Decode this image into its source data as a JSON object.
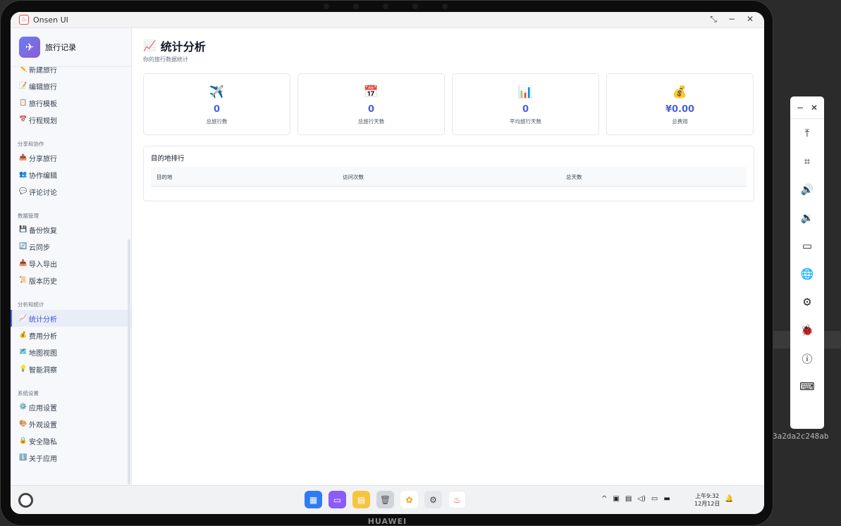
{
  "window": {
    "title": "Onsen UI"
  },
  "device": {
    "brand": "HUAWEI"
  },
  "sidebar": {
    "app_name": "旅行记录",
    "groups": [
      {
        "title": "",
        "items": [
          {
            "icon": "✏️",
            "label": "新建旅行",
            "partial": true
          },
          {
            "icon": "📝",
            "label": "编辑旅行"
          },
          {
            "icon": "📋",
            "label": "旅行模板"
          },
          {
            "icon": "📅",
            "label": "行程规划"
          }
        ]
      },
      {
        "title": "分享和协作",
        "items": [
          {
            "icon": "📤",
            "label": "分享旅行"
          },
          {
            "icon": "👥",
            "label": "协作编辑"
          },
          {
            "icon": "💬",
            "label": "评论讨论"
          }
        ]
      },
      {
        "title": "数据管理",
        "items": [
          {
            "icon": "💾",
            "label": "备份恢复"
          },
          {
            "icon": "🔄",
            "label": "云同步"
          },
          {
            "icon": "📥",
            "label": "导入导出"
          },
          {
            "icon": "📜",
            "label": "版本历史"
          }
        ]
      },
      {
        "title": "分析和统计",
        "items": [
          {
            "icon": "📈",
            "label": "统计分析",
            "active": true
          },
          {
            "icon": "💰",
            "label": "费用分析"
          },
          {
            "icon": "🗺️",
            "label": "地图视图"
          },
          {
            "icon": "💡",
            "label": "智能洞察"
          }
        ]
      },
      {
        "title": "系统设置",
        "items": [
          {
            "icon": "⚙️",
            "label": "应用设置"
          },
          {
            "icon": "🎨",
            "label": "外观设置"
          },
          {
            "icon": "🔒",
            "label": "安全隐私"
          },
          {
            "icon": "ℹ️",
            "label": "关于应用"
          }
        ]
      }
    ]
  },
  "main": {
    "title_icon": "📈",
    "title": "统计分析",
    "subtitle": "你的旅行数据统计",
    "stats": [
      {
        "icon": "✈️",
        "value": "0",
        "label": "总旅行数"
      },
      {
        "icon": "📅",
        "value": "0",
        "label": "总旅行天数"
      },
      {
        "icon": "📊",
        "value": "0",
        "label": "平均旅行天数"
      },
      {
        "icon": "💰",
        "value": "¥0.00",
        "label": "总费用"
      }
    ],
    "ranking": {
      "title": "目的地排行",
      "columns": [
        "目的地",
        "访问次数",
        "总天数"
      ]
    }
  },
  "taskbar": {
    "clock_time": "上午9:32",
    "clock_date": "12月12日"
  },
  "overlay_text": "3a2da2c248ab"
}
